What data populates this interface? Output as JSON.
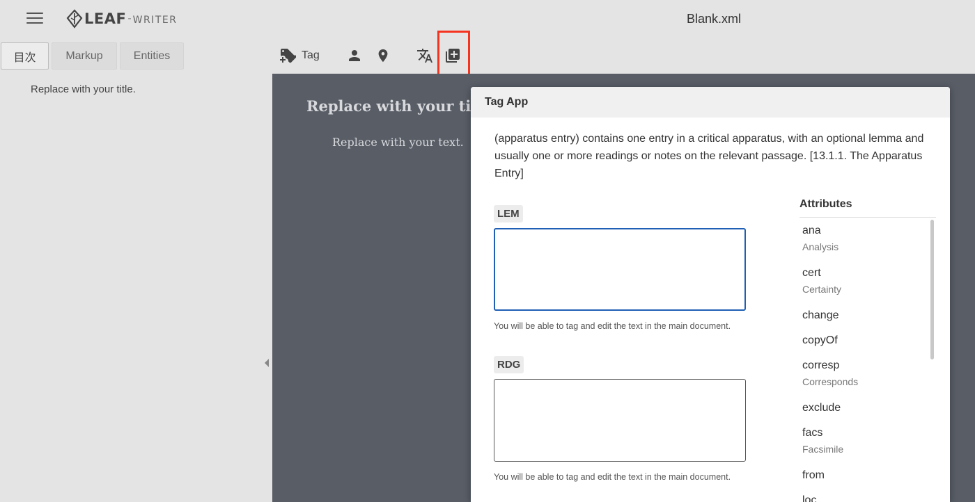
{
  "header": {
    "logo_leaf": "LEAF",
    "logo_sep": "-",
    "logo_writer": "WRITER",
    "doc_title": "Blank.xml"
  },
  "sidebar": {
    "tabs": [
      {
        "label": "目次",
        "active": true
      },
      {
        "label": "Markup",
        "active": false
      },
      {
        "label": "Entities",
        "active": false
      }
    ],
    "toc_items": [
      "Replace with your title."
    ]
  },
  "toolbar": {
    "tag_label": "Tag",
    "icons": [
      "tag-add-icon",
      "person-icon",
      "place-icon",
      "translate-icon",
      "note-add-icon"
    ]
  },
  "editor": {
    "title": "Replace with your title.",
    "text": "Replace with your text."
  },
  "dialog": {
    "title": "Tag App",
    "description": "(apparatus entry) contains one entry in a critical apparatus, with an optional lemma and usually one or more readings or notes on the relevant passage. [13.1.1. The Apparatus Entry]",
    "fields": [
      {
        "label": "LEM",
        "value": "",
        "help": "You will be able to tag and edit the text in the main document."
      },
      {
        "label": "RDG",
        "value": "",
        "help": "You will be able to tag and edit the text in the main document."
      }
    ],
    "attributes_title": "Attributes",
    "attributes": [
      {
        "name": "ana",
        "desc": "Analysis"
      },
      {
        "name": "cert",
        "desc": "Certainty"
      },
      {
        "name": "change",
        "desc": ""
      },
      {
        "name": "copyOf",
        "desc": ""
      },
      {
        "name": "corresp",
        "desc": "Corresponds"
      },
      {
        "name": "exclude",
        "desc": ""
      },
      {
        "name": "facs",
        "desc": "Facsimile"
      },
      {
        "name": "from",
        "desc": ""
      },
      {
        "name": "loc",
        "desc": ""
      }
    ]
  },
  "colors": {
    "editor_bg": "#585d66",
    "highlight": "#f4341f",
    "focus": "#1f5fb4"
  }
}
